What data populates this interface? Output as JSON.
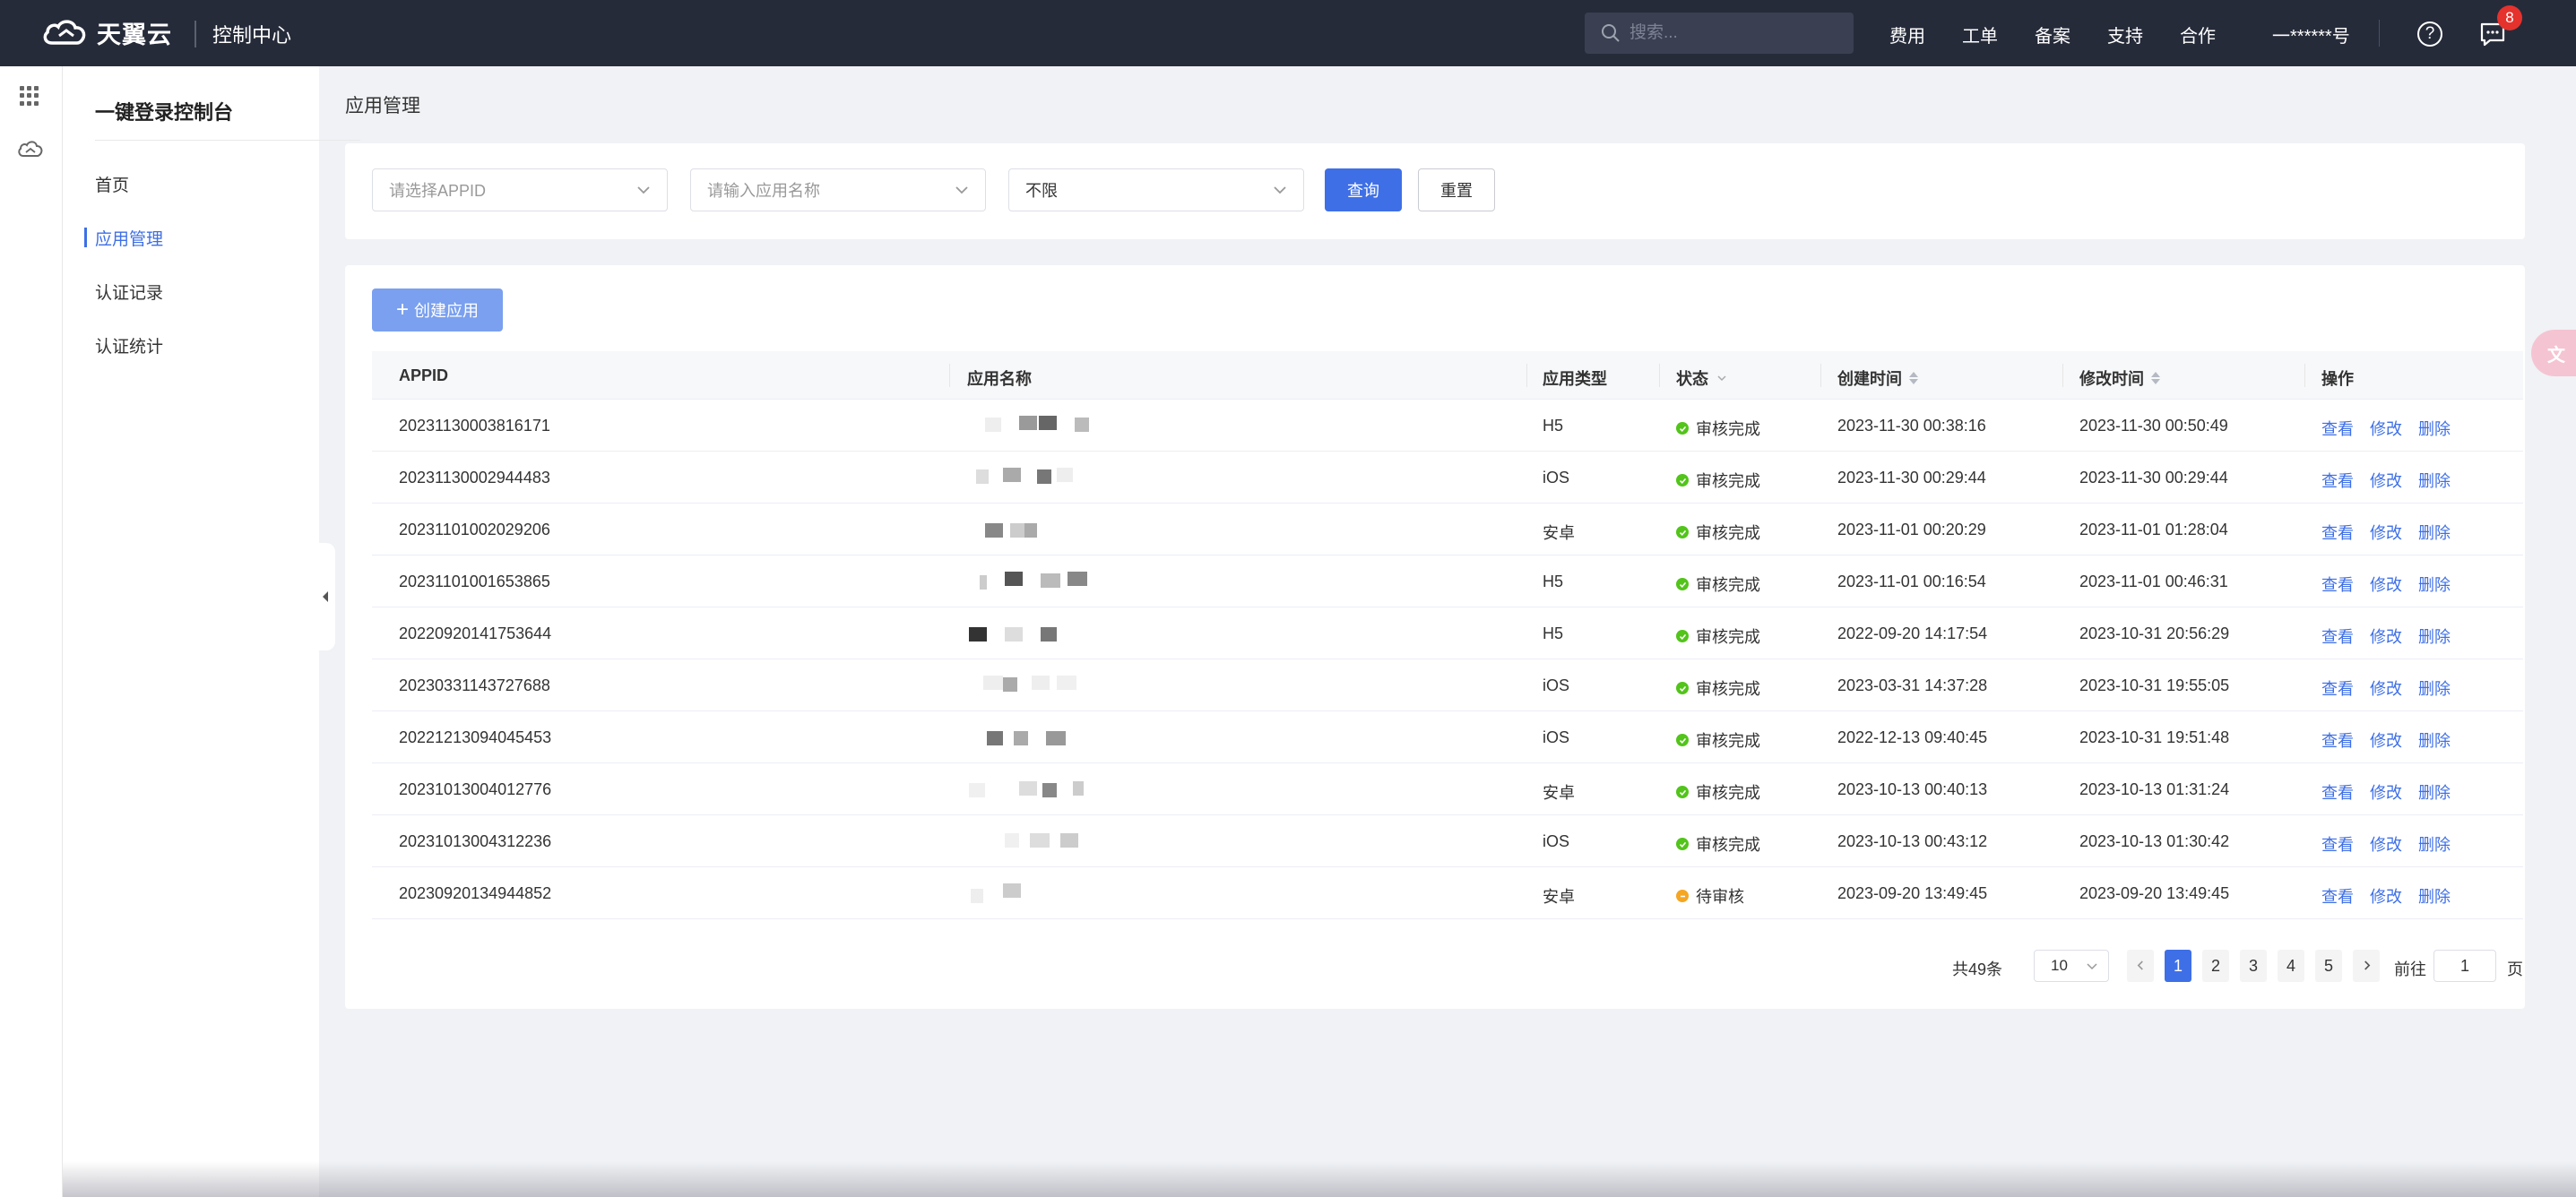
{
  "header": {
    "brand": "天翼云",
    "console_title": "控制中心",
    "search_placeholder": "搜索...",
    "nav": [
      "费用",
      "工单",
      "备案",
      "支持",
      "合作"
    ],
    "account": "一******号",
    "help": "?",
    "message_count": "8"
  },
  "sidebar": {
    "title": "一键登录控制台",
    "items": [
      {
        "label": "首页",
        "active": false
      },
      {
        "label": "应用管理",
        "active": true
      },
      {
        "label": "认证记录",
        "active": false
      },
      {
        "label": "认证统计",
        "active": false
      }
    ]
  },
  "page": {
    "title": "应用管理"
  },
  "filters": {
    "appid_placeholder": "请选择APPID",
    "name_placeholder": "请输入应用名称",
    "type_value": "不限",
    "query_label": "查询",
    "reset_label": "重置"
  },
  "table": {
    "create_label": "创建应用",
    "columns": [
      "APPID",
      "应用名称",
      "应用类型",
      "状态",
      "创建时间",
      "修改时间",
      "操作"
    ],
    "actions": [
      "查看",
      "修改",
      "删除"
    ],
    "rows": [
      {
        "appid": "20231130003816171",
        "type": "H5",
        "status": "审核完成",
        "status_color": "#52c41a",
        "created": "2023-11-30 00:38:16",
        "modified": "2023-11-30 00:50:49"
      },
      {
        "appid": "20231130002944483",
        "type": "iOS",
        "status": "审核完成",
        "status_color": "#52c41a",
        "created": "2023-11-30 00:29:44",
        "modified": "2023-11-30 00:29:44"
      },
      {
        "appid": "20231101002029206",
        "type": "安卓",
        "status": "审核完成",
        "status_color": "#52c41a",
        "created": "2023-11-01 00:20:29",
        "modified": "2023-11-01 01:28:04"
      },
      {
        "appid": "20231101001653865",
        "type": "H5",
        "status": "审核完成",
        "status_color": "#52c41a",
        "created": "2023-11-01 00:16:54",
        "modified": "2023-11-01 00:46:31"
      },
      {
        "appid": "20220920141753644",
        "type": "H5",
        "status": "审核完成",
        "status_color": "#52c41a",
        "created": "2022-09-20 14:17:54",
        "modified": "2023-10-31 20:56:29"
      },
      {
        "appid": "20230331143727688",
        "type": "iOS",
        "status": "审核完成",
        "status_color": "#52c41a",
        "created": "2023-03-31 14:37:28",
        "modified": "2023-10-31 19:55:05"
      },
      {
        "appid": "20221213094045453",
        "type": "iOS",
        "status": "审核完成",
        "status_color": "#52c41a",
        "created": "2022-12-13 09:40:45",
        "modified": "2023-10-31 19:51:48"
      },
      {
        "appid": "20231013004012776",
        "type": "安卓",
        "status": "审核完成",
        "status_color": "#52c41a",
        "created": "2023-10-13 00:40:13",
        "modified": "2023-10-13 01:31:24"
      },
      {
        "appid": "20231013004312236",
        "type": "iOS",
        "status": "审核完成",
        "status_color": "#52c41a",
        "created": "2023-10-13 00:43:12",
        "modified": "2023-10-13 01:30:42"
      },
      {
        "appid": "20230920134944852",
        "type": "安卓",
        "status": "待审核",
        "status_color": "#f5a623",
        "created": "2023-09-20 13:49:45",
        "modified": "2023-09-20 13:49:45"
      }
    ]
  },
  "pagination": {
    "total": "共49条",
    "page_size": "10",
    "pages": [
      "1",
      "2",
      "3",
      "4",
      "5"
    ],
    "current": "1",
    "goto_label": "前往",
    "goto_value": "1",
    "page_unit": "页"
  },
  "colors": {
    "primary": "#3e6fe6",
    "topbar": "#262b3a",
    "success": "#52c41a",
    "pending": "#f5a623",
    "badge": "#e5322d"
  }
}
